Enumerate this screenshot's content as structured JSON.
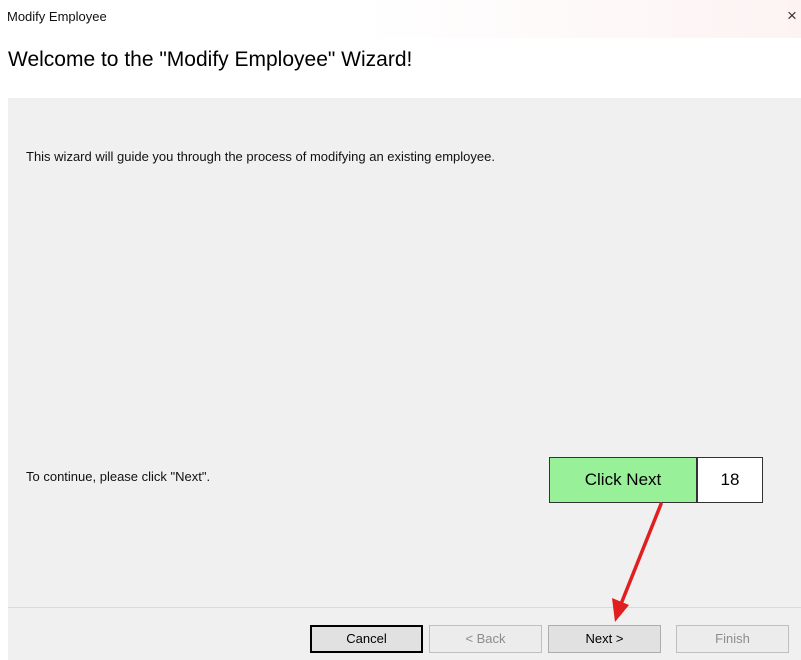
{
  "window": {
    "title": "Modify Employee",
    "close_glyph": "×"
  },
  "wizard": {
    "heading": "Welcome to the \"Modify Employee\" Wizard!",
    "intro_text": "This wizard will guide you through the process of modifying an existing employee.",
    "continue_text": "To continue, please click \"Next\"."
  },
  "buttons": {
    "cancel": "Cancel",
    "back": "< Back",
    "next": "Next >",
    "finish": "Finish"
  },
  "annotation": {
    "callout_text": "Click Next",
    "step_number": "18",
    "callout_color": "#98f098",
    "arrow_color": "#e02020"
  }
}
